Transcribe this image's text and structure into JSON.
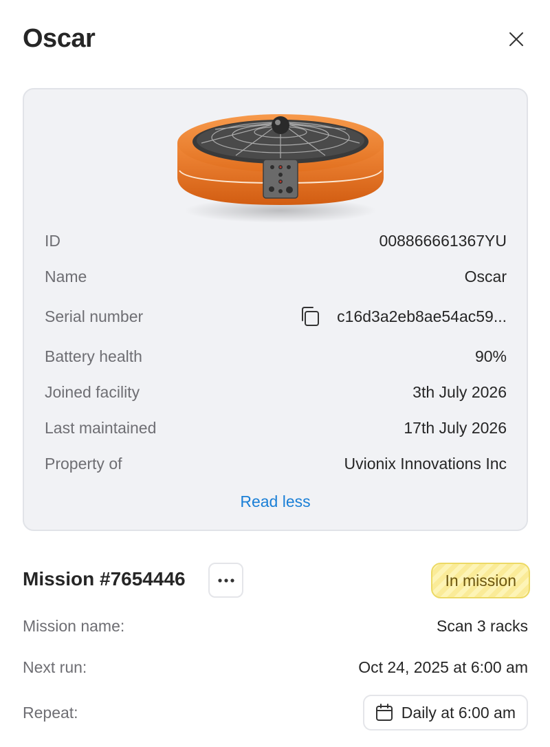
{
  "header": {
    "title": "Oscar",
    "close_icon": "close-icon"
  },
  "robot_card": {
    "image": "orange-drone-robot",
    "details": [
      {
        "label": "ID",
        "value": "008866661367YU"
      },
      {
        "label": "Name",
        "value": "Oscar"
      },
      {
        "label": "Serial number",
        "value": "c16d3a2eb8ae54ac59...",
        "icon": "copy-icon"
      },
      {
        "label": "Battery health",
        "value": "90%"
      },
      {
        "label": "Joined facility",
        "value": "3th July 2026"
      },
      {
        "label": "Last maintained",
        "value": "17th July 2026"
      },
      {
        "label": "Property of",
        "value": "Uvionix Innovations Inc"
      }
    ],
    "read_less_label": "Read less"
  },
  "mission": {
    "title": "Mission #7654446",
    "more_icon": "more-horizontal-icon",
    "status": "In mission",
    "rows": [
      {
        "label": "Mission name:",
        "value": "Scan 3 racks"
      },
      {
        "label": "Next run:",
        "value": "Oct 24, 2025 at 6:00 am"
      },
      {
        "label": "Repeat:",
        "value": "Daily at 6:00 am",
        "icon": "calendar-icon"
      }
    ]
  },
  "colors": {
    "accent_link": "#1a7fd6",
    "card_bg": "#f1f2f5",
    "status_bg": "#fdf4b6",
    "status_border": "#ecd964",
    "robot_body": "#e86f1c"
  }
}
